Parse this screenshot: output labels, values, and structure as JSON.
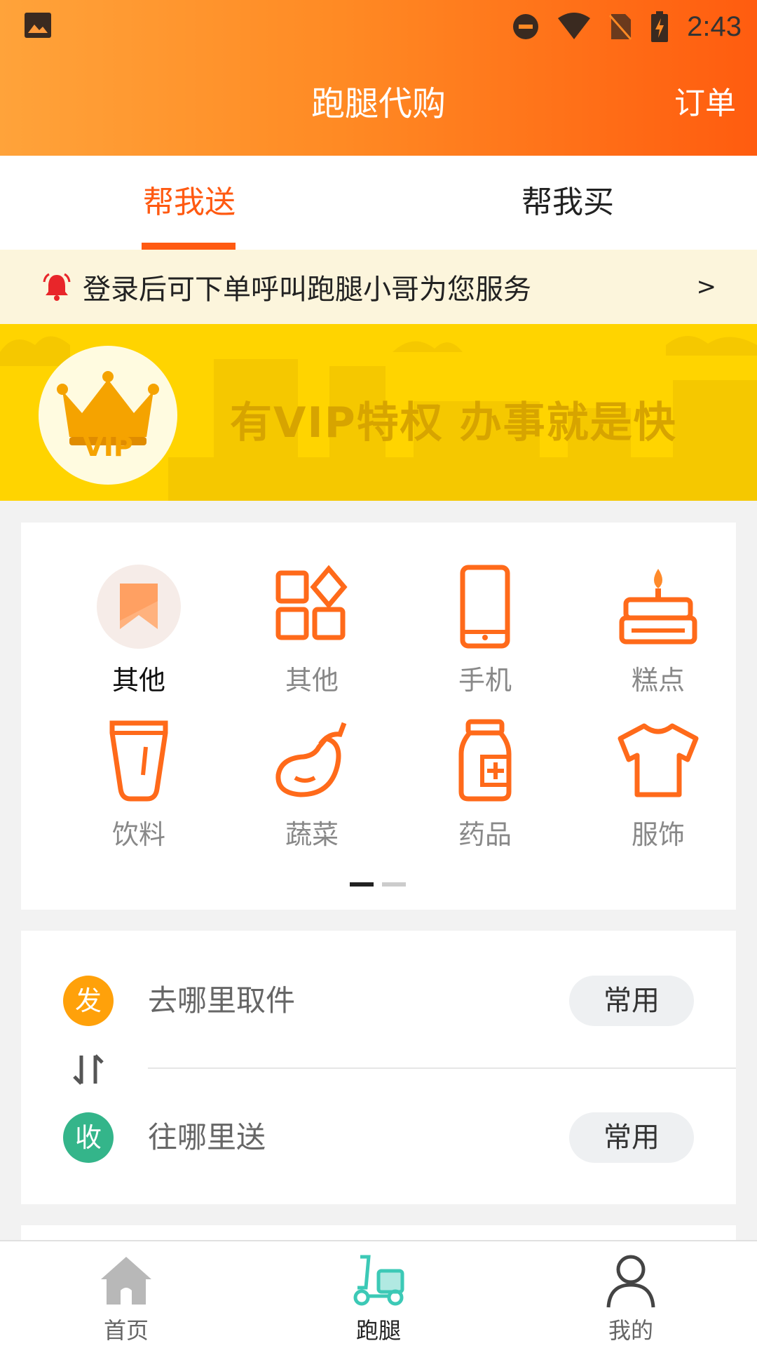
{
  "status_bar": {
    "time": "2:43"
  },
  "header": {
    "title": "跑腿代购",
    "order_link": "订单"
  },
  "tabs": [
    {
      "label": "帮我送",
      "active": true
    },
    {
      "label": "帮我买",
      "active": false
    }
  ],
  "notice": {
    "text": "登录后可下单呼叫跑腿小哥为您服务",
    "arrow": ">"
  },
  "banner": {
    "vip_label": "VIP",
    "text": "有VIP特权  办事就是快"
  },
  "categories": [
    {
      "label": "其他",
      "icon": "bookmark-icon",
      "active": true
    },
    {
      "label": "其他",
      "icon": "grid-icon",
      "active": false
    },
    {
      "label": "手机",
      "icon": "phone-icon",
      "active": false
    },
    {
      "label": "糕点",
      "icon": "cake-icon",
      "active": false
    },
    {
      "label": "饮料",
      "icon": "drink-icon",
      "active": false
    },
    {
      "label": "蔬菜",
      "icon": "eggplant-icon",
      "active": false
    },
    {
      "label": "药品",
      "icon": "medicine-icon",
      "active": false
    },
    {
      "label": "服饰",
      "icon": "shirt-icon",
      "active": false
    }
  ],
  "pager": {
    "pages": 2,
    "current": 1
  },
  "address": {
    "pickup": {
      "badge": "发",
      "placeholder": "去哪里取件",
      "common": "常用"
    },
    "delivery": {
      "badge": "收",
      "placeholder": "往哪里送",
      "common": "常用"
    }
  },
  "bottom_nav": [
    {
      "label": "首页",
      "icon": "home-icon",
      "active": false
    },
    {
      "label": "跑腿",
      "icon": "scooter-icon",
      "active": true
    },
    {
      "label": "我的",
      "icon": "user-icon",
      "active": false
    }
  ],
  "colors": {
    "accent": "#ff5a12",
    "banner": "#ffd400",
    "pickup_badge": "#ffa10a",
    "delivery_badge": "#34b58a",
    "nav_active": "#3cc9b6"
  }
}
